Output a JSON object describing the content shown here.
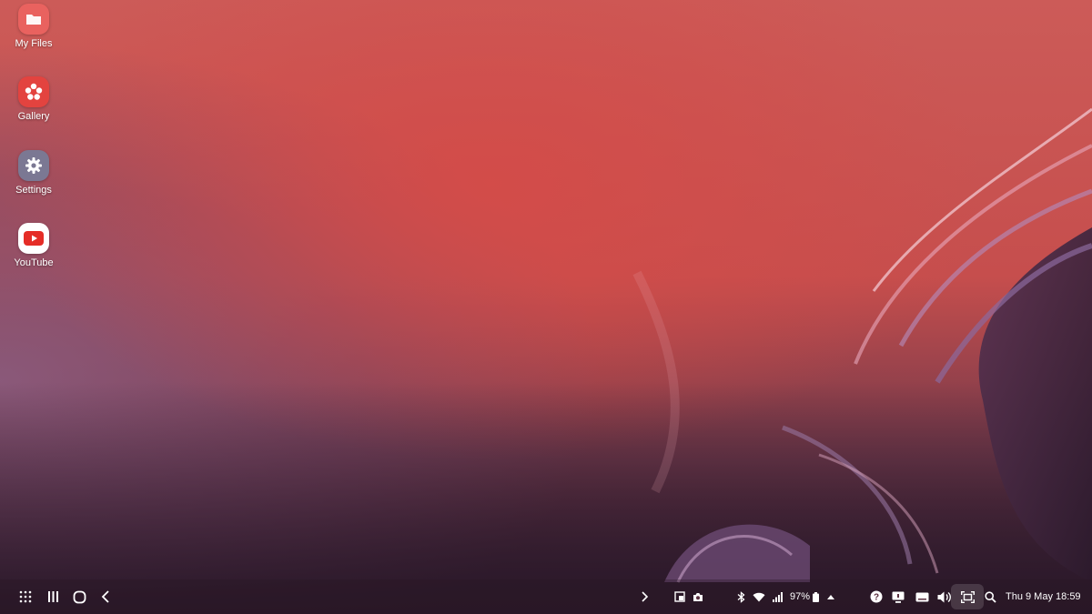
{
  "desktop": {
    "icons": [
      {
        "label": "My Files",
        "icon": "folder-icon",
        "color": "#e9625f"
      },
      {
        "label": "Gallery",
        "icon": "flower-icon",
        "color": "#e3433f"
      },
      {
        "label": "Settings",
        "icon": "gear-icon",
        "color": "#7b7893"
      },
      {
        "label": "YouTube",
        "icon": "play-icon",
        "color": "#ffffff"
      }
    ]
  },
  "taskbar": {
    "left_buttons": [
      "apps-grid-icon",
      "recents-icon",
      "home-icon",
      "back-icon"
    ],
    "expand_icon": "chevron-right-icon",
    "pinned_icons": [
      "screenshot-icon",
      "camera-icon"
    ],
    "status": {
      "icons": [
        "bluetooth-icon",
        "wifi-icon",
        "signal-icon"
      ],
      "battery_percent": "97%",
      "battery_icon": "battery-icon",
      "notifications_icon": "caret-up-icon"
    },
    "quick_icons": [
      "help-icon",
      "desktop-mode-icon",
      "keyboard-icon",
      "volume-icon",
      "screen-capture-icon",
      "search-icon"
    ],
    "datetime": "Thu 9 May 18:59"
  },
  "colors": {
    "wallpaper_top": "#cf5a57",
    "wallpaper_bottom": "#2f1c2e",
    "text": "#ffffff"
  }
}
